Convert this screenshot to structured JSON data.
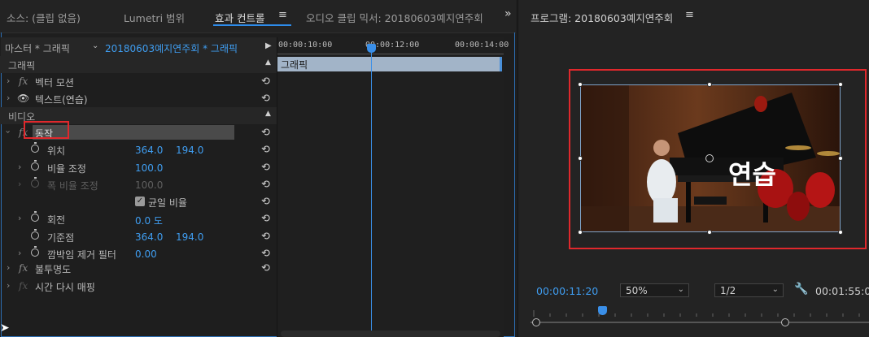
{
  "tabs": [
    {
      "label": "소스: (클립 없음)"
    },
    {
      "label": "Lumetri 범위"
    },
    {
      "label": "효과 컨트롤"
    },
    {
      "label": "오디오 클립 믹서: 20180603예지연주회"
    }
  ],
  "menu_icon": "hamburger-icon",
  "overflow_glyph": "»",
  "master_label": "마스터 * 그래픽",
  "clip_label": "20180603예지연주회 * 그래픽",
  "sections": {
    "graphics": "그래픽",
    "video": "비디오"
  },
  "effects": {
    "vector_motion": "벡터 모션",
    "text": "텍스트(연습)",
    "motion": "동작",
    "opacity": "불투명도",
    "time_remap": "시간 다시 매핑"
  },
  "params": {
    "position": {
      "label": "위치",
      "x": "364.0",
      "y": "194.0"
    },
    "scale": {
      "label": "비율 조정",
      "value": "100.0"
    },
    "scale_width": {
      "label": "폭 비율 조정",
      "value": "100.0"
    },
    "uniform_scale": {
      "label": "균일 비율",
      "checked": true
    },
    "rotation": {
      "label": "회전",
      "value": "0.0 도"
    },
    "anchor": {
      "label": "기준점",
      "x": "364.0",
      "y": "194.0"
    },
    "flicker": {
      "label": "깜박임 제거 필터",
      "value": "0.00"
    }
  },
  "timeline": {
    "tc1": "00:00:10:00",
    "tc2": "00:00:12:00",
    "tc3": "00:00:14:00",
    "clip_name": "그래픽"
  },
  "program": {
    "title": "프로그램: 20180603예지연주회",
    "overlay_text": "연습",
    "timecode": "00:00:11:20",
    "zoom": "50%",
    "resolution": "1/2",
    "duration": "00:01:55:0"
  },
  "colors": {
    "accent": "#2d8ceb",
    "timecode": "#3f9df0",
    "highlight_box": "#e0282c"
  }
}
